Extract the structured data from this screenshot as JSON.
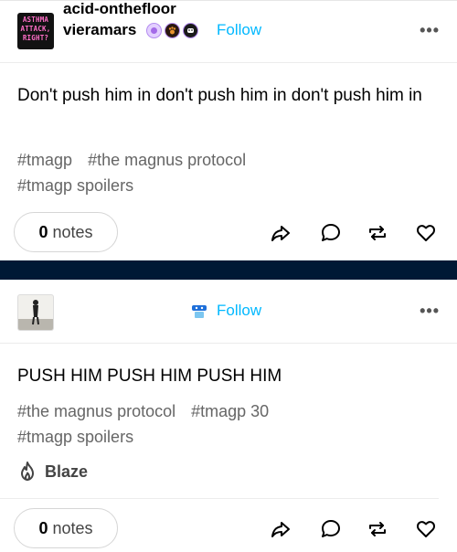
{
  "posts": [
    {
      "avatar_text": "ASTHMA ATTACK, RIGHT?",
      "username": "vieramars",
      "follow_label": "Follow",
      "more_label": "•••",
      "body": "Don't push him in don't push him in don't push him in",
      "tags": [
        "#tmagp",
        "#the magnus protocol",
        "#tmagp spoilers"
      ],
      "notes_count": "0",
      "notes_label": "notes"
    },
    {
      "username": "acid-onthefloor",
      "follow_label": "Follow",
      "more_label": "•••",
      "body": "PUSH HIM PUSH HIM PUSH HIM",
      "tags": [
        "#the magnus protocol",
        "#tmagp 30",
        "#tmagp spoilers"
      ],
      "blaze_label": "Blaze",
      "notes_count": "0",
      "notes_label": "notes"
    }
  ],
  "icons": {
    "share": "share-icon",
    "reply": "reply-icon",
    "reblog": "reblog-icon",
    "like": "heart-icon",
    "blaze": "flame-icon"
  },
  "colors": {
    "follow": "#00b8ff",
    "divider": "#001935",
    "tag": "#666666"
  }
}
